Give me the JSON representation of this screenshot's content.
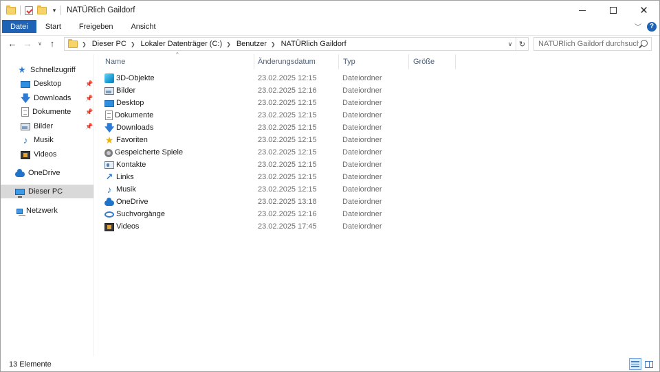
{
  "window": {
    "title": "NATÜRlich Gaildorf"
  },
  "ribbon": {
    "tabs": [
      "Datei",
      "Start",
      "Freigeben",
      "Ansicht"
    ]
  },
  "address": {
    "crumbs": [
      "Dieser PC",
      "Lokaler Datenträger (C:)",
      "Benutzer",
      "NATÜRlich Gaildorf"
    ]
  },
  "search": {
    "placeholder": "NATÜRlich Gaildorf durchsuch..."
  },
  "navpane": {
    "quick_access": "Schnellzugriff",
    "quick_items": [
      {
        "label": "Desktop",
        "icon": "desktop-icon",
        "pinned": true
      },
      {
        "label": "Downloads",
        "icon": "download-icon",
        "pinned": true
      },
      {
        "label": "Dokumente",
        "icon": "document-icon",
        "pinned": true
      },
      {
        "label": "Bilder",
        "icon": "pictures-icon",
        "pinned": true
      },
      {
        "label": "Musik",
        "icon": "music-icon",
        "pinned": false
      },
      {
        "label": "Videos",
        "icon": "video-icon",
        "pinned": false
      }
    ],
    "onedrive": "OneDrive",
    "this_pc": "Dieser PC",
    "network": "Netzwerk"
  },
  "columns": {
    "name": "Name",
    "date": "Änderungsdatum",
    "type": "Typ",
    "size": "Größe"
  },
  "files": [
    {
      "name": "3D-Objekte",
      "date": "23.02.2025 12:15",
      "type": "Dateiordner",
      "icon": "3d-objects-icon"
    },
    {
      "name": "Bilder",
      "date": "23.02.2025 12:16",
      "type": "Dateiordner",
      "icon": "pictures-icon"
    },
    {
      "name": "Desktop",
      "date": "23.02.2025 12:15",
      "type": "Dateiordner",
      "icon": "desktop-icon"
    },
    {
      "name": "Dokumente",
      "date": "23.02.2025 12:15",
      "type": "Dateiordner",
      "icon": "document-icon"
    },
    {
      "name": "Downloads",
      "date": "23.02.2025 12:15",
      "type": "Dateiordner",
      "icon": "download-icon"
    },
    {
      "name": "Favoriten",
      "date": "23.02.2025 12:15",
      "type": "Dateiordner",
      "icon": "favorites-star-icon"
    },
    {
      "name": "Gespeicherte Spiele",
      "date": "23.02.2025 12:15",
      "type": "Dateiordner",
      "icon": "saved-games-icon"
    },
    {
      "name": "Kontakte",
      "date": "23.02.2025 12:15",
      "type": "Dateiordner",
      "icon": "contacts-icon"
    },
    {
      "name": "Links",
      "date": "23.02.2025 12:15",
      "type": "Dateiordner",
      "icon": "link-arrow-icon"
    },
    {
      "name": "Musik",
      "date": "23.02.2025 12:15",
      "type": "Dateiordner",
      "icon": "music-icon"
    },
    {
      "name": "OneDrive",
      "date": "23.02.2025 13:18",
      "type": "Dateiordner",
      "icon": "onedrive-cloud-icon"
    },
    {
      "name": "Suchvorgänge",
      "date": "23.02.2025 12:16",
      "type": "Dateiordner",
      "icon": "search-magnifier-icon"
    },
    {
      "name": "Videos",
      "date": "23.02.2025 17:45",
      "type": "Dateiordner",
      "icon": "video-icon"
    }
  ],
  "status": {
    "item_count": "13 Elemente"
  },
  "colors": {
    "accent": "#1e63b6",
    "selected_nav": "#d9d9d9",
    "column_header": "#4c607a",
    "secondary_text": "#6d6d6d"
  }
}
